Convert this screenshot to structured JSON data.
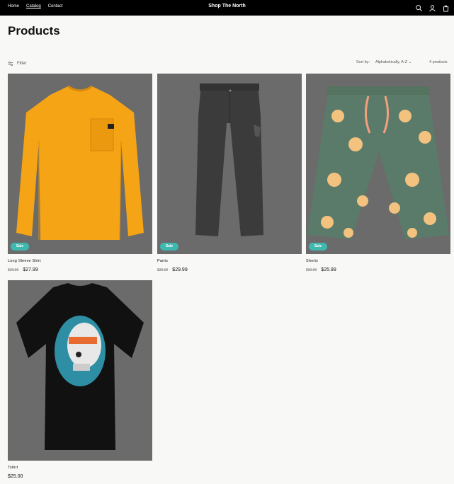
{
  "header": {
    "nav": [
      {
        "label": "Home",
        "active": false
      },
      {
        "label": "Catalog",
        "active": true
      },
      {
        "label": "Contact",
        "active": false
      }
    ],
    "brand": "Shop The North",
    "icons": [
      "search-icon",
      "account-icon",
      "cart-icon"
    ]
  },
  "page": {
    "title": "Products",
    "filter_label": "Filter",
    "sort_label": "Sort by:",
    "sort_value": "Alphabetically, A-Z",
    "product_count": "4 products"
  },
  "products": [
    {
      "name": "Long Sleeve Shirt",
      "badge": "Sale",
      "old_price": "$39.99",
      "price": "$27.99",
      "image": "orange long sleeve shirt"
    },
    {
      "name": "Pants",
      "badge": "Sale",
      "old_price": "$39.99",
      "price": "$29.99",
      "image": "grey pants"
    },
    {
      "name": "Shorts",
      "badge": "Sale",
      "old_price": "$39.99",
      "price": "$25.99",
      "image": "green floral shorts"
    },
    {
      "name": "Tshirt",
      "badge": "",
      "old_price": "",
      "price": "$25.00",
      "image": "black skull t-shirt"
    }
  ],
  "colors": {
    "header_bg": "#000000",
    "badge": "#3fb8af",
    "image_bg": "#6b6b6b"
  }
}
